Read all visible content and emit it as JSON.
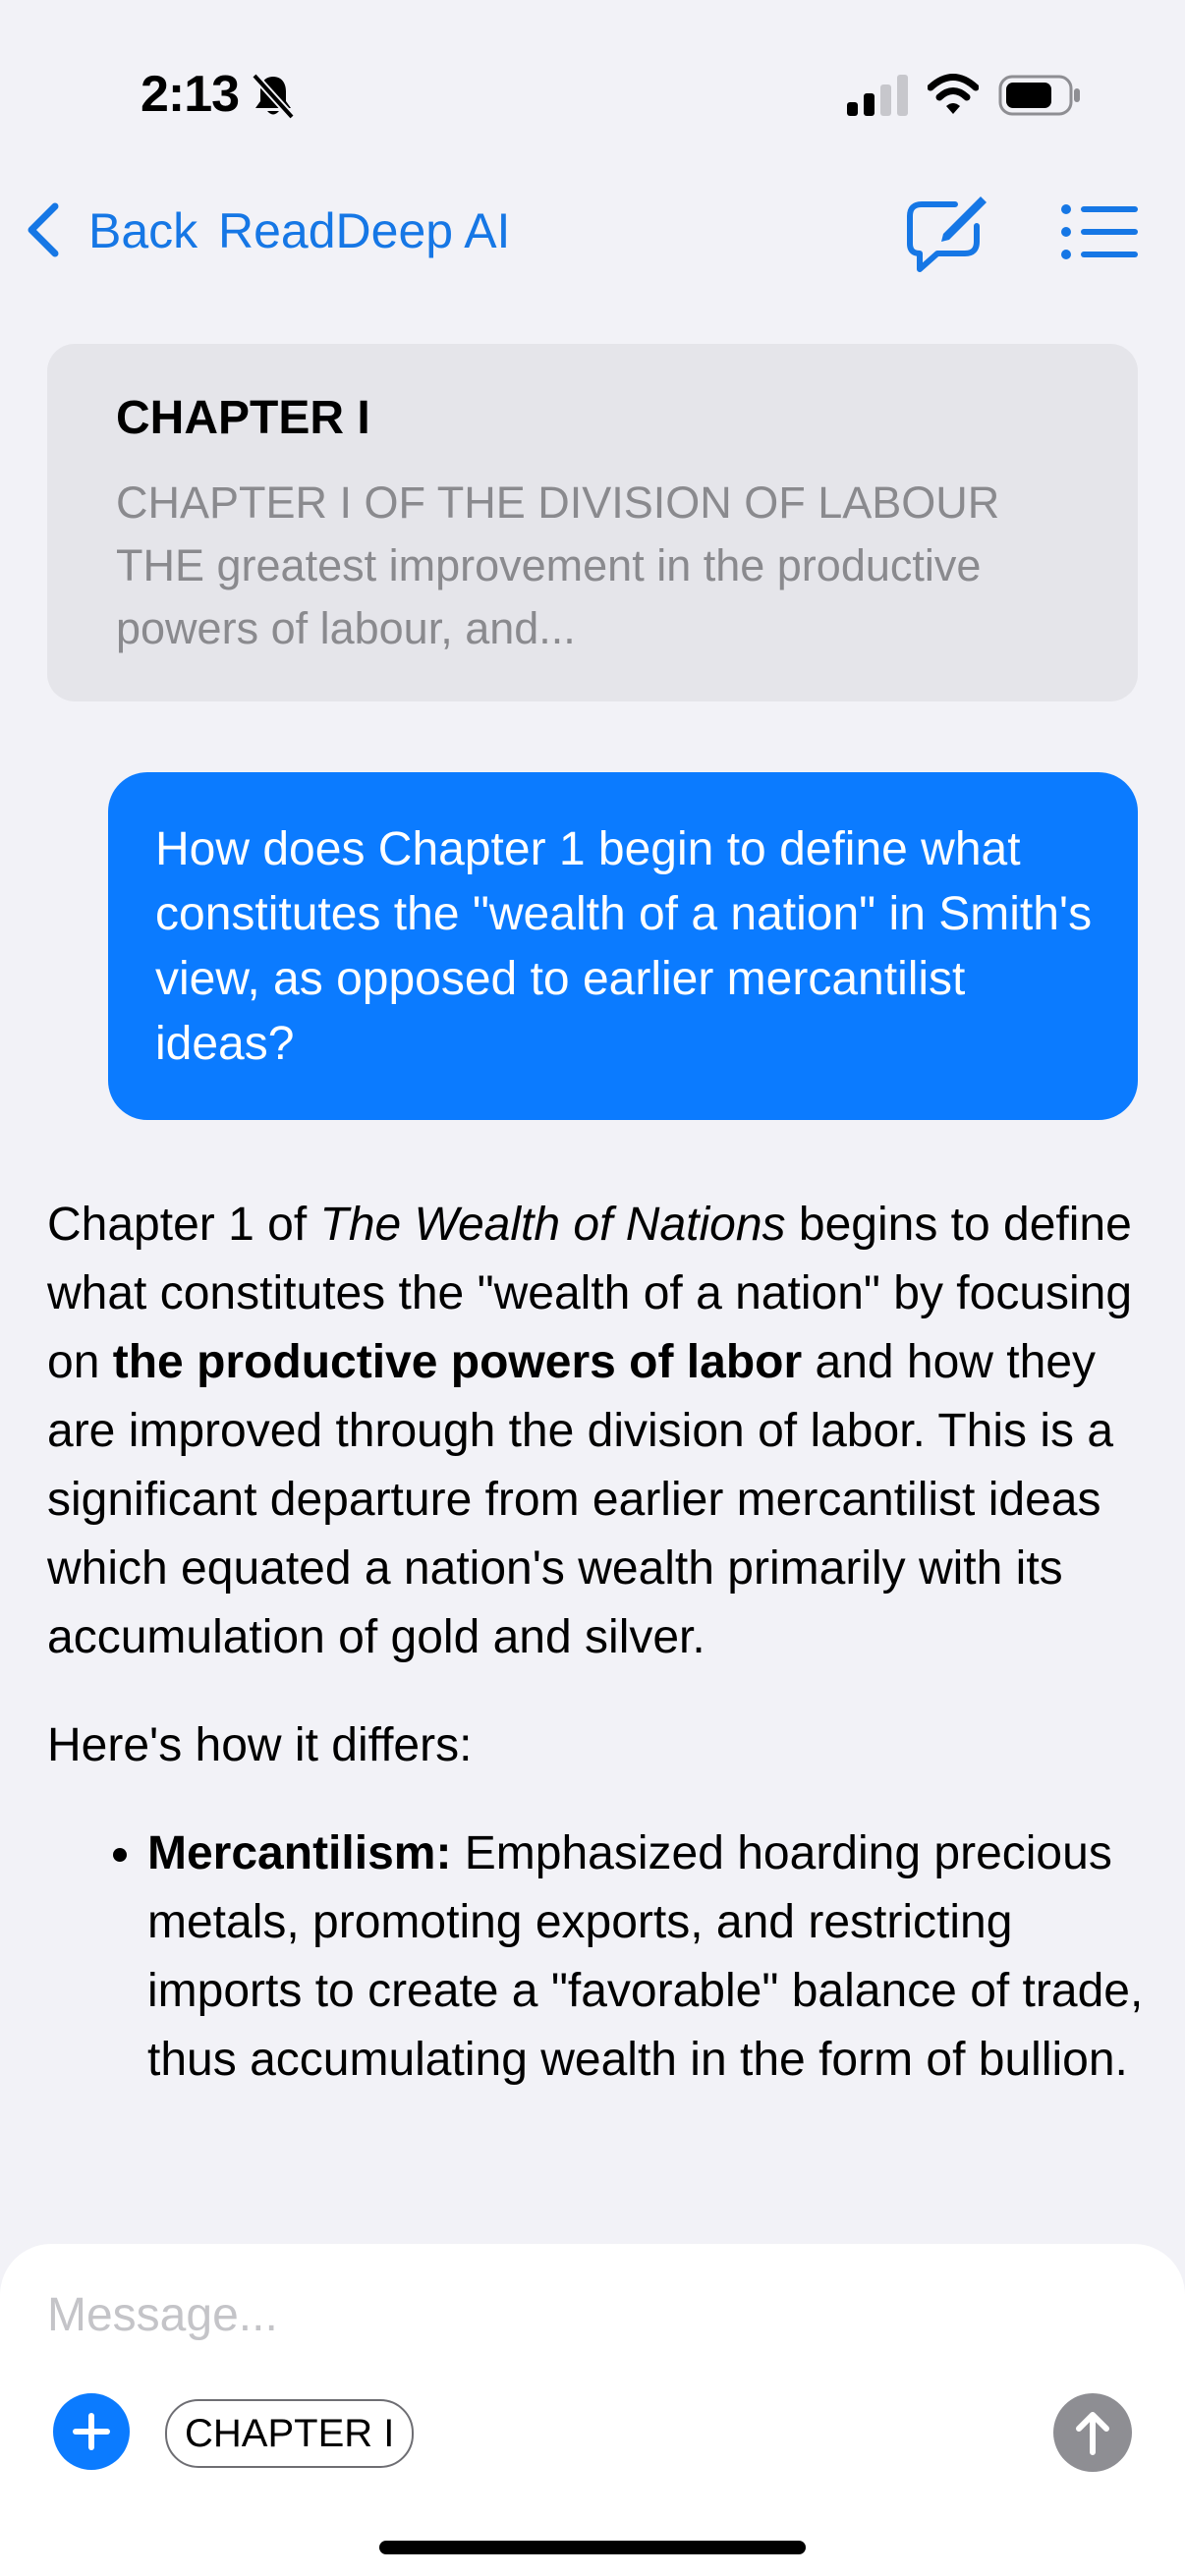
{
  "status_bar": {
    "time": "2:13",
    "icons": [
      "bell-slash-icon",
      "cellular-signal-icon",
      "wifi-icon",
      "battery-icon"
    ]
  },
  "nav": {
    "back_label": "Back",
    "title": "ReadDeep AI",
    "icons": [
      "chevron-left-icon",
      "compose-icon",
      "list-icon"
    ],
    "accent_color": "#1677e5"
  },
  "chapter_card": {
    "title": "CHAPTER I",
    "excerpt": "CHAPTER I OF THE DIVISION OF LABOUR THE greatest improvement in the productive powers of labour, and..."
  },
  "user_message": {
    "text": "How does Chapter 1 begin to define what constitutes the \"wealth of a nation\" in Smith's view, as opposed to earlier mercantilist ideas?",
    "bubble_color": "#0b7bff"
  },
  "answer": {
    "p1": {
      "part1": "Chapter 1 of ",
      "book_title": "The Wealth of Nations",
      "part2": " begins to define what constitutes the \"wealth of a nation\" by focusing on ",
      "emphasis": "the productive powers of labor",
      "part3": " and how they are improved through the division of labor. This is a significant departure from earlier mercantilist ideas which equated a nation's wealth primarily with its accumulation of gold and silver."
    },
    "p2": "Here's how it differs:",
    "bullets": [
      {
        "term": "Mercantilism:",
        "text": " Emphasized hoarding precious metals, promoting exports, and restricting imports to create a \"favorable\" balance of trade, thus accumulating wealth in the form of bullion."
      }
    ]
  },
  "composer": {
    "placeholder": "Message...",
    "chip_label": "CHAPTER I",
    "icons": [
      "plus-icon",
      "arrow-up-icon"
    ]
  }
}
